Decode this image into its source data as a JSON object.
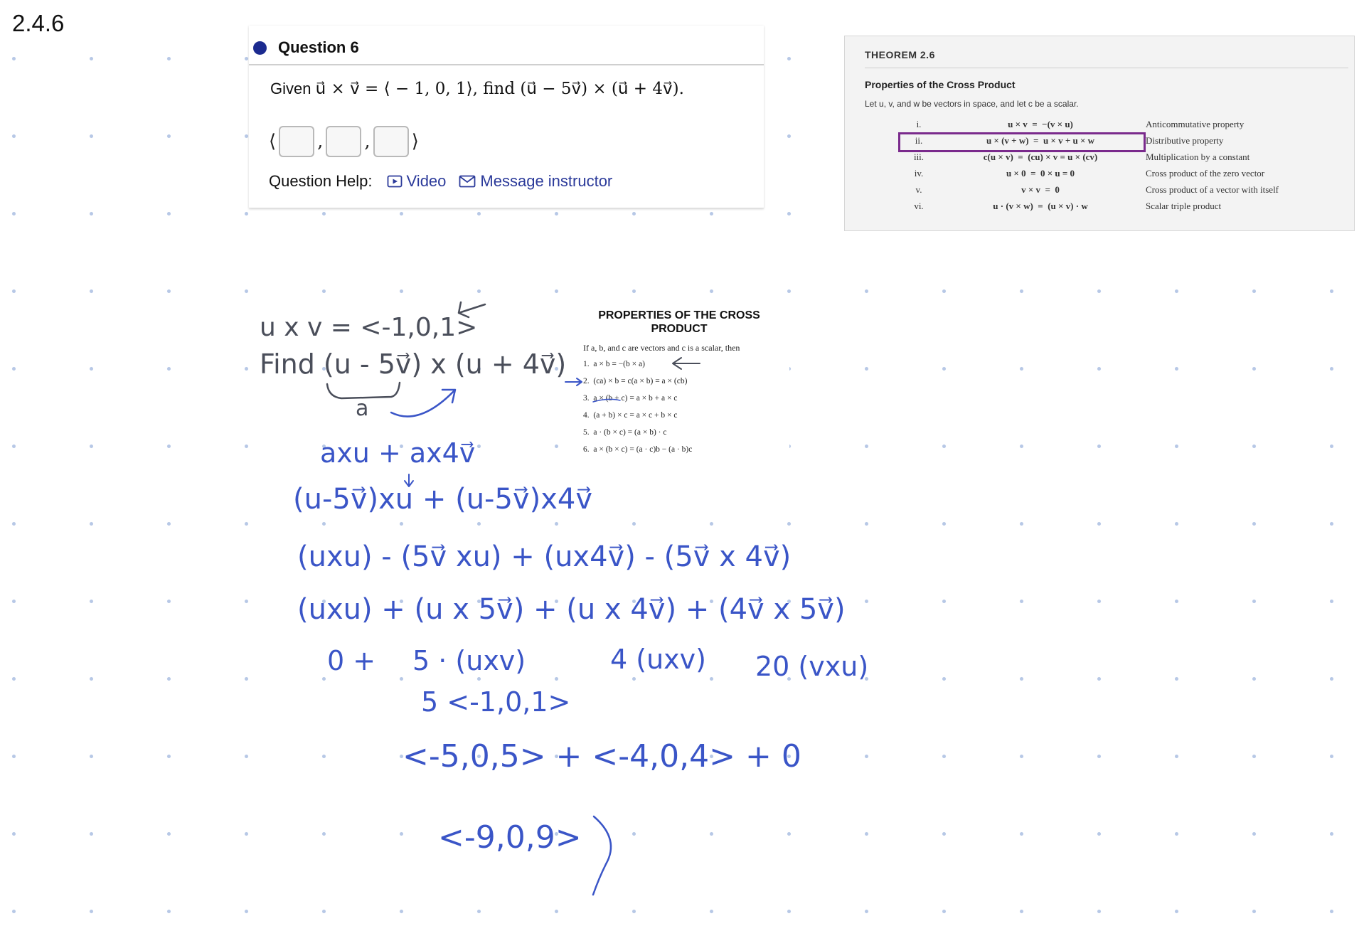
{
  "page_label": "2.4.6",
  "question": {
    "title": "Question 6",
    "prompt_lead": "Given",
    "prompt_math": "u⃗ × v⃗ = ⟨ − 1, 0, 1⟩, find (u⃗ − 5v⃗) × (u⃗ + 4v⃗).",
    "answer_open": "⟨",
    "answer_close": "⟩",
    "answer_separator": ",",
    "help_label": "Question Help:",
    "video_label": "Video",
    "message_label": "Message instructor",
    "accent_color": "#1b2a8f"
  },
  "theorem": {
    "heading": "THEOREM 2.6",
    "subheading": "Properties of the Cross Product",
    "intro": "Let u, v, and w be vectors in space, and let c be a scalar.",
    "rows": [
      {
        "num": "i.",
        "formula": "u × v  =  −(v × u)",
        "desc": "Anticommutative property"
      },
      {
        "num": "ii.",
        "formula": "u × (v + w)  =  u × v + u × w",
        "desc": "Distributive property"
      },
      {
        "num": "iii.",
        "formula": "c(u × v)  =  (cu) × v = u × (cv)",
        "desc": "Multiplication by a constant"
      },
      {
        "num": "iv.",
        "formula": "u × 0  =  0 × u = 0",
        "desc": "Cross product of the zero vector"
      },
      {
        "num": "v.",
        "formula": "v × v  =  0",
        "desc": "Cross product of a vector with itself"
      },
      {
        "num": "vi.",
        "formula": "u · (v × w)  =  (u × v) · w",
        "desc": "Scalar triple product"
      }
    ],
    "highlight_color": "#7a2a8c"
  },
  "properties": {
    "title_line1": "PROPERTIES OF THE CROSS",
    "title_line2": "PRODUCT",
    "intro": "If a, b, and c are vectors and c is a scalar, then",
    "items": [
      "1.  a × b = −(b × a)",
      "2.  (ca) × b = c(a × b) = a × (cb)",
      "3.  a × (b + c) = a × b + a × c",
      "4.  (a + b) × c = a × c + b × c",
      "5.  a · (b × c) = (a × b) · c",
      "6.  a × (b × c) = (a · c)b − (a · b)c"
    ]
  },
  "handwriting": {
    "dark_lines": [
      "u x v = <-1,0,1>",
      "Find (u - 5v⃗) x (u + 4v⃗)",
      "a"
    ],
    "blue_lines": [
      "axu + ax4v⃗",
      "(u-5v⃗)xu + (u-5v⃗)x4v⃗",
      "(uxu) - (5v⃗ xu) + (ux4v⃗) - (5v⃗ x 4v⃗)",
      "(uxu) + (u x 5v⃗) + (u x 4v⃗) + (4v⃗ x 5v⃗)",
      "0 +",
      "5 · (uxv)",
      "4 (uxv)",
      "20 (vxu)",
      "5 <-1,0,1>",
      "<-5,0,5> + <-4,0,4> + 0",
      "<-9,0,9>"
    ],
    "ink_blue": "#3a55c7",
    "ink_dark": "#4a4e5a"
  }
}
